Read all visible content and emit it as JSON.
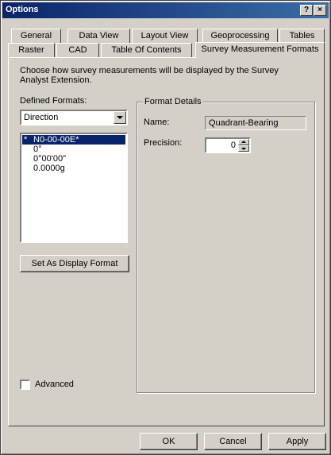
{
  "window": {
    "title": "Options",
    "help_glyph": "?",
    "close_glyph": "×"
  },
  "tabs": {
    "row_back": [
      "General",
      "Data View",
      "Layout View",
      "Geoprocessing",
      "Tables"
    ],
    "row_front": [
      "Raster",
      "CAD",
      "Table Of Contents",
      "Survey Measurement Formats"
    ],
    "active": "Survey Measurement Formats"
  },
  "page": {
    "description": "Choose how survey measurements will be displayed by the Survey Analyst Extension.",
    "defined_formats_label": "Defined Formats:",
    "format_type_selected": "Direction",
    "formats": [
      {
        "mark": "*",
        "label": "N0-00-00E*",
        "selected": true
      },
      {
        "mark": "",
        "label": "0°",
        "selected": false
      },
      {
        "mark": "",
        "label": "0°00'00\"",
        "selected": false
      },
      {
        "mark": "",
        "label": "0.0000g",
        "selected": false
      }
    ],
    "set_display_button": "Set As Display Format",
    "advanced_label": "Advanced",
    "advanced_checked": false,
    "format_details": {
      "legend": "Format Details",
      "name_label": "Name:",
      "name_value": "Quadrant-Bearing",
      "precision_label": "Precision:",
      "precision_value": "0"
    }
  },
  "footer": {
    "ok": "OK",
    "cancel": "Cancel",
    "apply": "Apply"
  }
}
